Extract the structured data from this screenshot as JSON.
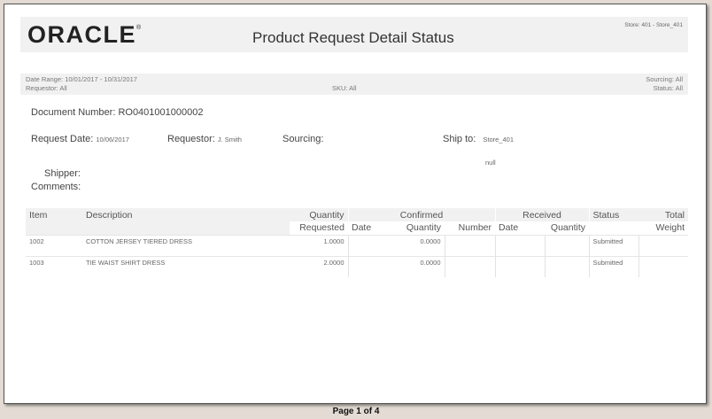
{
  "header": {
    "logo": "ORACLE",
    "title": "Product Request Detail Status",
    "store": "Store: 401 - Store_401"
  },
  "filters": {
    "date_range": "Date Range: 10/01/2017 - 10/31/2017",
    "requestor": "Requestor: All",
    "sku": "SKU: All",
    "sourcing": "Sourcing: All",
    "status": "Status: All"
  },
  "document": {
    "number_label": "Document Number:",
    "number_value": "RO0401001000002",
    "request_date_label": "Request Date:",
    "request_date_value": "10/06/2017",
    "requestor_label": "Requestor:",
    "requestor_value": "J. Smith",
    "sourcing_label": "Sourcing:",
    "ship_to_label": "Ship to:",
    "ship_to_value": "Store_401",
    "ship_to_address": "null",
    "shipper_label": "Shipper:",
    "comments_label": "Comments:"
  },
  "table": {
    "headers": {
      "item": "Item",
      "description": "Description",
      "quantity": "Quantity",
      "requested": "Requested",
      "confirmed": "Confirmed",
      "received": "Received",
      "date": "Date",
      "conf_quantity": "Quantity",
      "number": "Number",
      "recv_date": "Date",
      "recv_quantity": "Quantity",
      "status": "Status",
      "total": "Total",
      "weight": "Weight"
    },
    "rows": [
      {
        "item": "1002",
        "description": "COTTON JERSEY TIERED DRESS",
        "requested": "1.0000",
        "conf_date": "",
        "conf_quantity": "0.0000",
        "number": "",
        "recv_date": "",
        "recv_quantity": "",
        "status": "Submitted",
        "weight": ""
      },
      {
        "item": "1003",
        "description": "TIE WAIST SHIRT DRESS",
        "requested": "2.0000",
        "conf_date": "",
        "conf_quantity": "0.0000",
        "number": "",
        "recv_date": "",
        "recv_quantity": "",
        "status": "Submitted",
        "weight": ""
      }
    ]
  },
  "footer": {
    "page": "Page 1 of 4"
  }
}
